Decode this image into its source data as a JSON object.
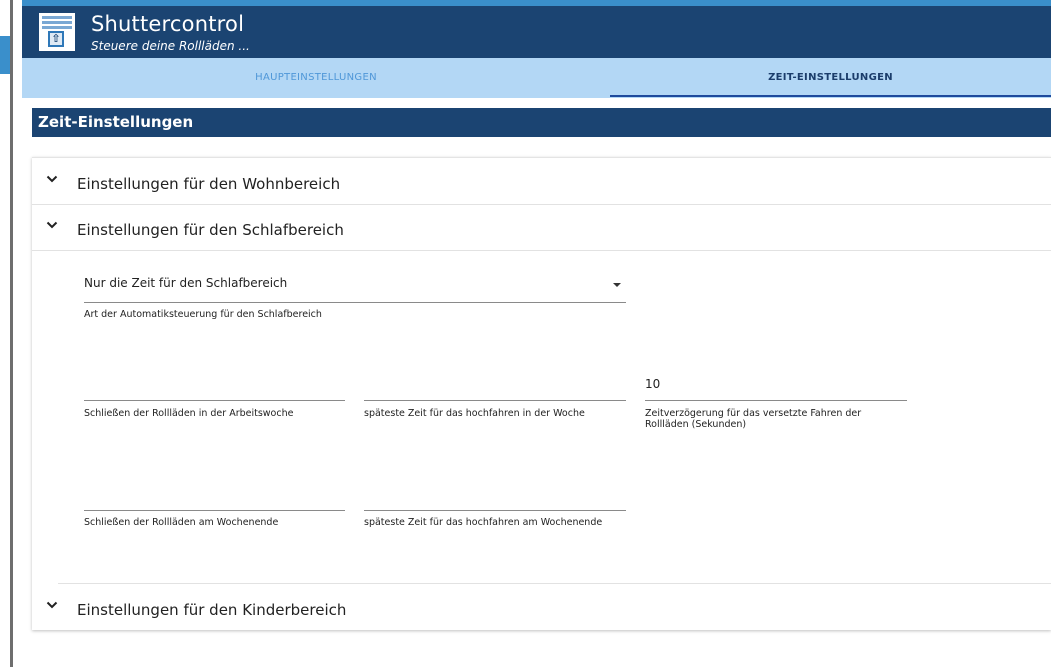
{
  "app": {
    "title": "Shuttercontrol",
    "subtitle": "Steuere deine Rollläden ...",
    "logo_icon": "shutter-logo-icon",
    "colors": {
      "header": "#1b4472",
      "accent": "#3a8fcb",
      "tabs": "#b3d7f5"
    }
  },
  "tabs": [
    {
      "label": "HAUPTEINSTELLUNGEN",
      "active": false
    },
    {
      "label": "ZEIT-EINSTELLUNGEN",
      "active": true
    }
  ],
  "section": {
    "title": "Zeit-Einstellungen"
  },
  "panels": [
    {
      "title": "Einstellungen für den Wohnbereich",
      "icon": "chevron-down-icon"
    },
    {
      "title": "Einstellungen für den Schlafbereich",
      "icon": "chevron-down-icon"
    },
    {
      "title": "Einstellungen für den Kinderbereich",
      "icon": "chevron-down-icon"
    }
  ],
  "schlafbereich": {
    "mode_select": {
      "value": "Nur die Zeit für den Schlafbereich",
      "helper": "Art der Automatiksteuerung für den Schlafbereich"
    },
    "fields": [
      {
        "value": "",
        "helper": "Schließen der Rollläden in der Arbeitswoche"
      },
      {
        "value": "",
        "helper": "späteste Zeit für das hochfahren in der Woche"
      },
      {
        "value": "10",
        "helper": "Zeitverzögerung für das versetzte Fahren der Rollläden (Sekunden)"
      },
      {
        "value": "",
        "helper": "Schließen der Rollläden am Wochenende"
      },
      {
        "value": "",
        "helper": "späteste Zeit für das hochfahren am Wochenende"
      }
    ]
  }
}
